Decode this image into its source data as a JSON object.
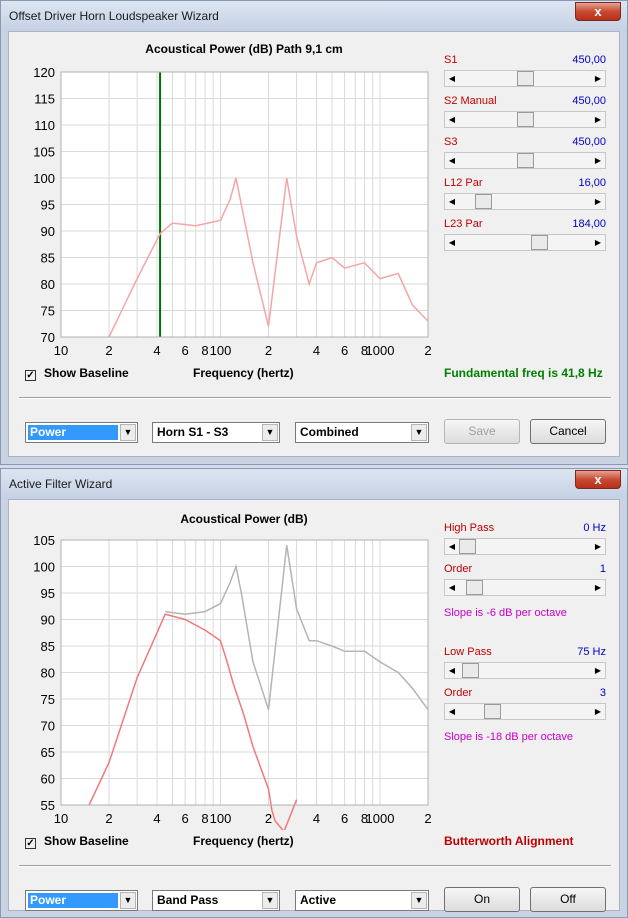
{
  "window1": {
    "title": "Offset Driver Horn Loudspeaker Wizard",
    "close_label": "x",
    "chart_title": "Acoustical Power (dB)   Path 9,1 cm",
    "x_label": "Frequency (hertz)",
    "y_ticks": [
      "120",
      "115",
      "110",
      "105",
      "100",
      "95",
      "90",
      "85",
      "80",
      "75",
      "70"
    ],
    "x_ticks": [
      "10",
      "2",
      "4",
      "6",
      "8",
      "100",
      "2",
      "4",
      "6",
      "8",
      "1000",
      "2"
    ],
    "sliders": [
      {
        "label": "S1",
        "value": "450,00",
        "position": 0.5
      },
      {
        "label": "S2  Manual",
        "value": "450,00",
        "position": 0.5
      },
      {
        "label": "S3",
        "value": "450,00",
        "position": 0.5
      },
      {
        "label": "L12  Par",
        "value": "16,00",
        "position": 0.14
      },
      {
        "label": "L23  Par",
        "value": "184,00",
        "position": 0.63
      }
    ],
    "show_baseline_label": "Show Baseline",
    "fundamental_text": "Fundamental freq is 41,8 Hz",
    "combo1": "Power",
    "combo2": "Horn S1 - S3",
    "combo3": "Combined",
    "save_label": "Save",
    "cancel_label": "Cancel"
  },
  "window2": {
    "title": "Active Filter Wizard",
    "close_label": "x",
    "chart_title": "Acoustical Power (dB)",
    "x_label": "Frequency (hertz)",
    "y_ticks": [
      "105",
      "100",
      "95",
      "90",
      "85",
      "80",
      "75",
      "70",
      "65",
      "60",
      "55"
    ],
    "x_ticks": [
      "10",
      "2",
      "4",
      "6",
      "8",
      "100",
      "2",
      "4",
      "6",
      "8",
      "1000",
      "2"
    ],
    "high_pass": {
      "label": "High Pass",
      "value": "0 Hz",
      "position": 0.0
    },
    "high_order": {
      "label": "Order",
      "value": "1",
      "position": 0.06
    },
    "high_slope": "Slope is -6 dB per octave",
    "low_pass": {
      "label": "Low Pass",
      "value": "75 Hz",
      "position": 0.03
    },
    "low_order": {
      "label": "Order",
      "value": "3",
      "position": 0.22
    },
    "low_slope": "Slope is -18 dB per octave",
    "show_baseline_label": "Show Baseline",
    "alignment_text": "Butterworth Alignment",
    "combo1": "Power",
    "combo2": "Band Pass",
    "combo3": "Active",
    "on_label": "On",
    "off_label": "Off"
  },
  "colors": {
    "curve_pink": "#f4a6a6",
    "filter_red": "#f07a7a",
    "baseline_gray": "#b4b4b4",
    "fundamental_line": "#007000",
    "hint_magenta": "#c800c8",
    "value_blue": "#0000c8",
    "label_red": "#c00000",
    "note_green": "#008000"
  },
  "chart_data": [
    {
      "type": "line",
      "title": "Acoustical Power (dB)   Path 9,1 cm",
      "xlabel": "Frequency (hertz)",
      "ylabel": "",
      "x_scale": "log",
      "xlim": [
        10,
        2000
      ],
      "ylim": [
        70,
        120
      ],
      "fundamental_hz": 41.8,
      "series": [
        {
          "x": [
            20,
            30,
            41.8,
            50,
            70,
            100,
            115,
            125,
            135,
            160,
            200,
            260,
            300,
            360,
            400,
            500,
            600,
            800,
            1000,
            1300,
            1600,
            2000
          ],
          "y": [
            70,
            81,
            89.5,
            91.5,
            91,
            92,
            96,
            100,
            95,
            84,
            72,
            100,
            89,
            80,
            84,
            85,
            83,
            84,
            81,
            82,
            76,
            73
          ]
        }
      ]
    },
    {
      "type": "line",
      "title": "Acoustical Power (dB)",
      "xlabel": "Frequency (hertz)",
      "ylabel": "",
      "x_scale": "log",
      "xlim": [
        10,
        2000
      ],
      "ylim": [
        55,
        105
      ],
      "series": [
        {
          "x": [
            15,
            20,
            30,
            45,
            60,
            80,
            100,
            110,
            120,
            140,
            160,
            200,
            210,
            220,
            250,
            300
          ],
          "y": [
            55,
            63,
            79,
            91,
            90,
            88,
            86,
            82,
            78,
            72,
            66,
            58,
            54,
            52,
            50,
            56
          ]
        },
        {
          "x": [
            45,
            60,
            80,
            100,
            115,
            125,
            135,
            160,
            200,
            260,
            300,
            360,
            400,
            500,
            600,
            800,
            1000,
            1300,
            1600,
            2000
          ],
          "y": [
            91.5,
            91,
            91.5,
            93,
            97,
            100,
            95,
            82,
            73,
            104,
            92,
            86,
            86,
            85,
            84,
            84,
            82,
            80,
            77,
            73
          ]
        }
      ]
    }
  ]
}
